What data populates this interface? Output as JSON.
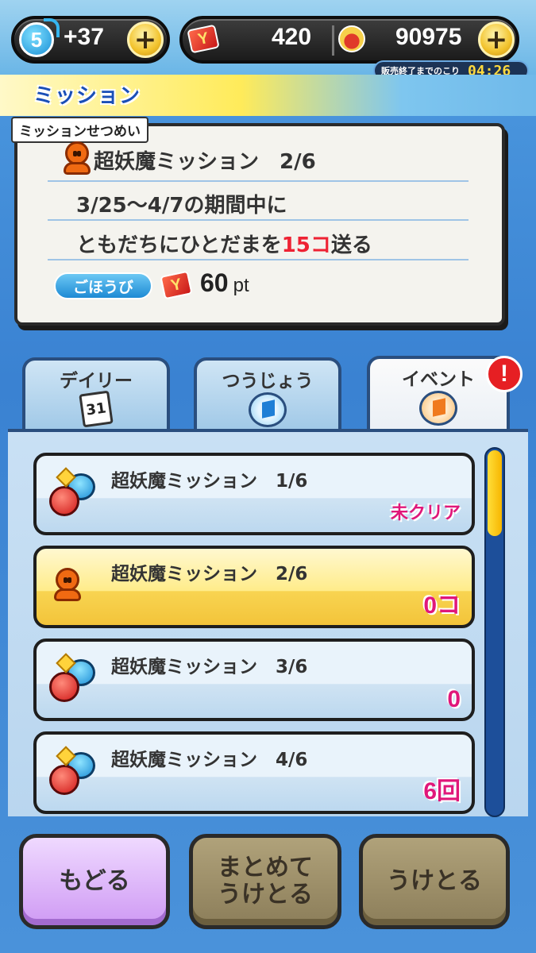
{
  "status_bar": {
    "level": "5",
    "stamina_bonus": "+37",
    "points": "420",
    "money": "90975",
    "timer_label": "販売終了までのこり",
    "timer_value": "04:26"
  },
  "header": {
    "title": "ミッション"
  },
  "description": {
    "label": "ミッションせつめい",
    "title": "超妖魔ミッション　2/6",
    "line1": "3/25〜4/7の期間中に",
    "line2_prefix": "ともだちにひとだまを",
    "line2_highlight": "15コ",
    "line2_suffix": "送る",
    "reward_label": "ごほうび",
    "reward_value": "60",
    "reward_unit": "pt"
  },
  "tabs": [
    {
      "label": "デイリー",
      "icon": "calendar-icon",
      "icon_text": "31"
    },
    {
      "label": "つうじょう",
      "icon": "blue-flag-icon"
    },
    {
      "label": "イベント",
      "icon": "orange-flag-icon",
      "alert": "!"
    }
  ],
  "missions": [
    {
      "name": "超妖魔ミッション　1/6",
      "status": "未クリア",
      "icon": "monster-icon"
    },
    {
      "name": "超妖魔ミッション　2/6",
      "status": "0コ",
      "icon": "person-icon",
      "active": true
    },
    {
      "name": "超妖魔ミッション　3/6",
      "status": "0",
      "icon": "monster-icon"
    },
    {
      "name": "超妖魔ミッション　4/6",
      "status": "6回",
      "icon": "monster-icon"
    }
  ],
  "buttons": {
    "back": "もどる",
    "receive_all": "まとめて\nうけとる",
    "receive": "うけとる"
  },
  "colors": {
    "accent_blue": "#3f86d4",
    "highlight_red": "#ee2233",
    "status_pink": "#e0177a",
    "active_yellow": "#ffec8a"
  }
}
